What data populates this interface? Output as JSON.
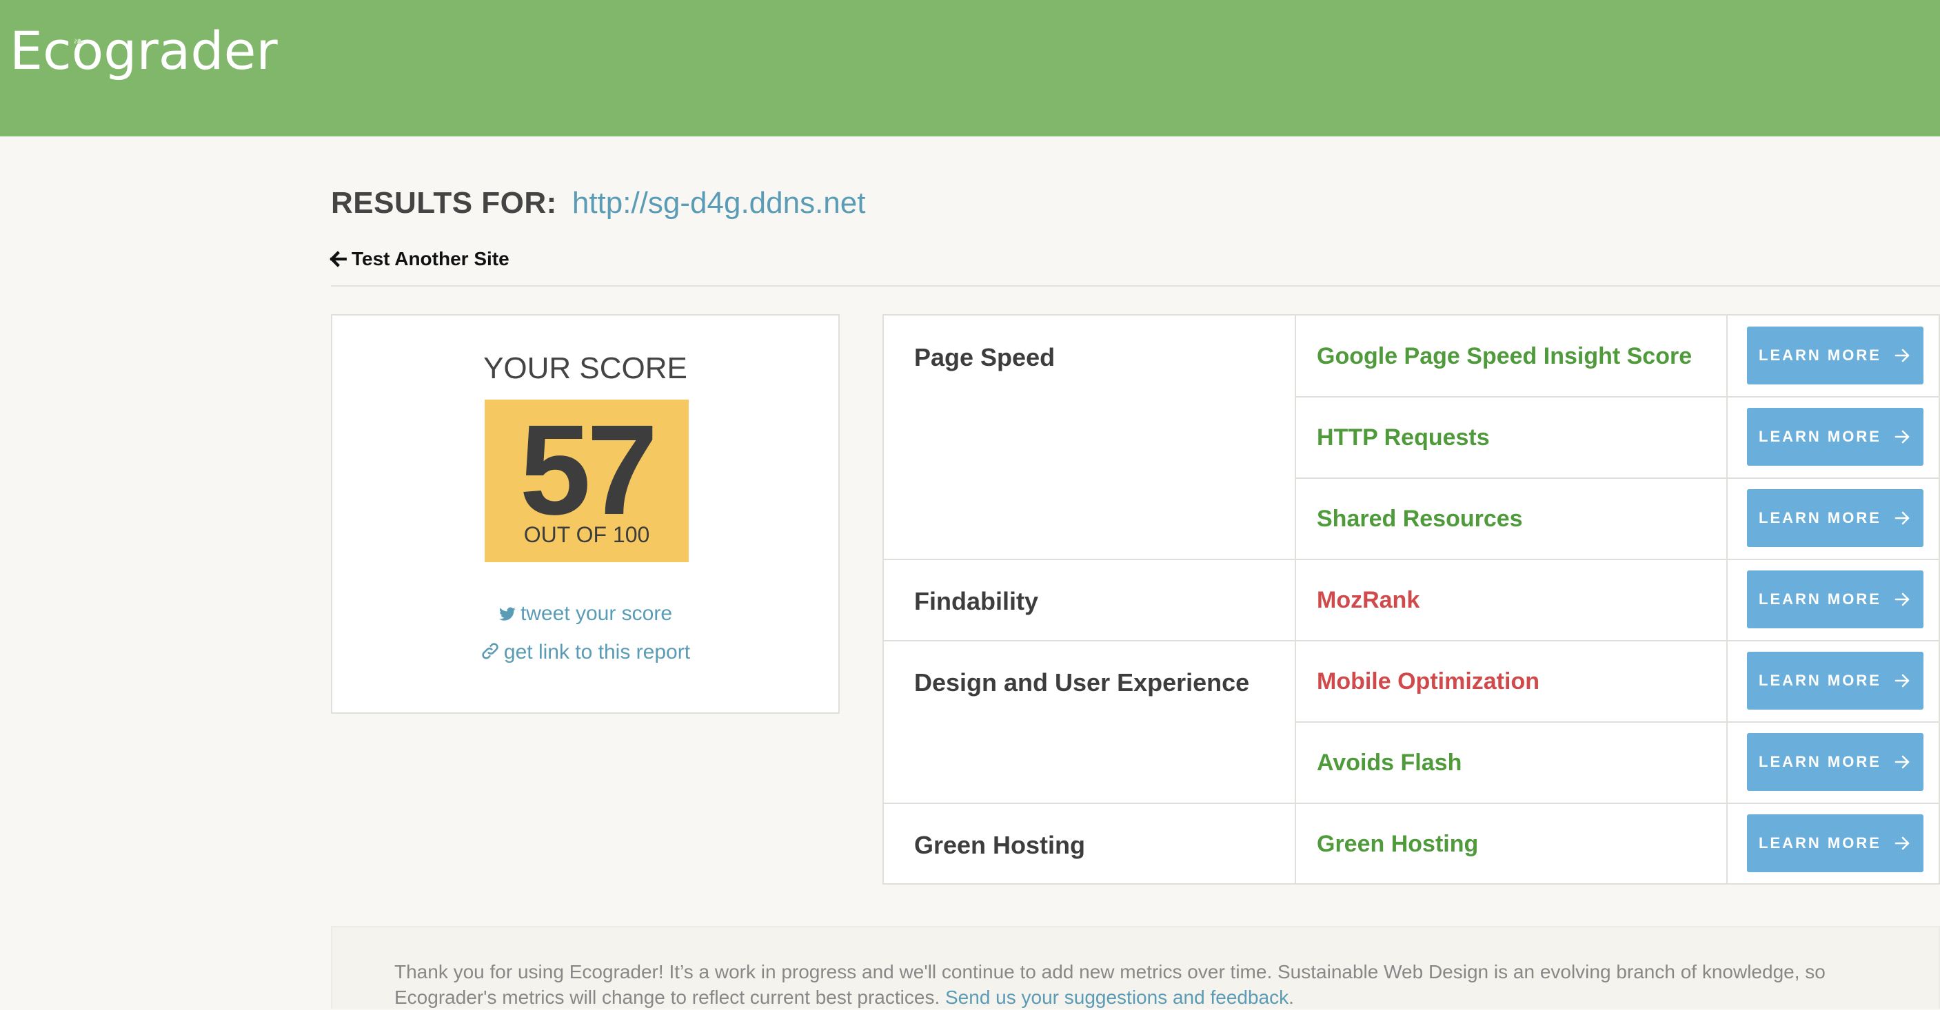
{
  "header": {
    "logo_text": "Ecograder",
    "background_color": "#81b76a"
  },
  "results": {
    "label": "RESULTS FOR:",
    "url": "http://sg-d4g.ddns.net",
    "back_link": "Test Another Site"
  },
  "score": {
    "title": "YOUR SCORE",
    "value": "57",
    "out_of": "OUT OF 100",
    "badge_color": "#f6c862",
    "tweet_link": "tweet your score",
    "report_link": "get link to this report"
  },
  "metrics": {
    "button_label": "LEARN MORE",
    "button_color": "#6aaedb",
    "good_color": "#4f9a3b",
    "bad_color": "#d0494b",
    "categories": [
      {
        "name": "Page Speed",
        "items": [
          {
            "label": "Google Page Speed Insight Score",
            "status": "good"
          },
          {
            "label": "HTTP Requests",
            "status": "good"
          },
          {
            "label": "Shared Resources",
            "status": "good"
          }
        ]
      },
      {
        "name": "Findability",
        "items": [
          {
            "label": "MozRank",
            "status": "bad"
          }
        ]
      },
      {
        "name": "Design and User Experience",
        "items": [
          {
            "label": "Mobile Optimization",
            "status": "bad"
          },
          {
            "label": "Avoids Flash",
            "status": "good"
          }
        ]
      },
      {
        "name": "Green Hosting",
        "items": [
          {
            "label": "Green Hosting",
            "status": "good"
          }
        ]
      }
    ]
  },
  "footer": {
    "text": "Thank you for using Ecograder! It’s a work in progress and we'll continue to add new metrics over time. Sustainable Web Design is an evolving branch of knowledge, so Ecograder's metrics will change to reflect current best practices.",
    "link": "Send us your suggestions and feedback",
    "end": "."
  }
}
